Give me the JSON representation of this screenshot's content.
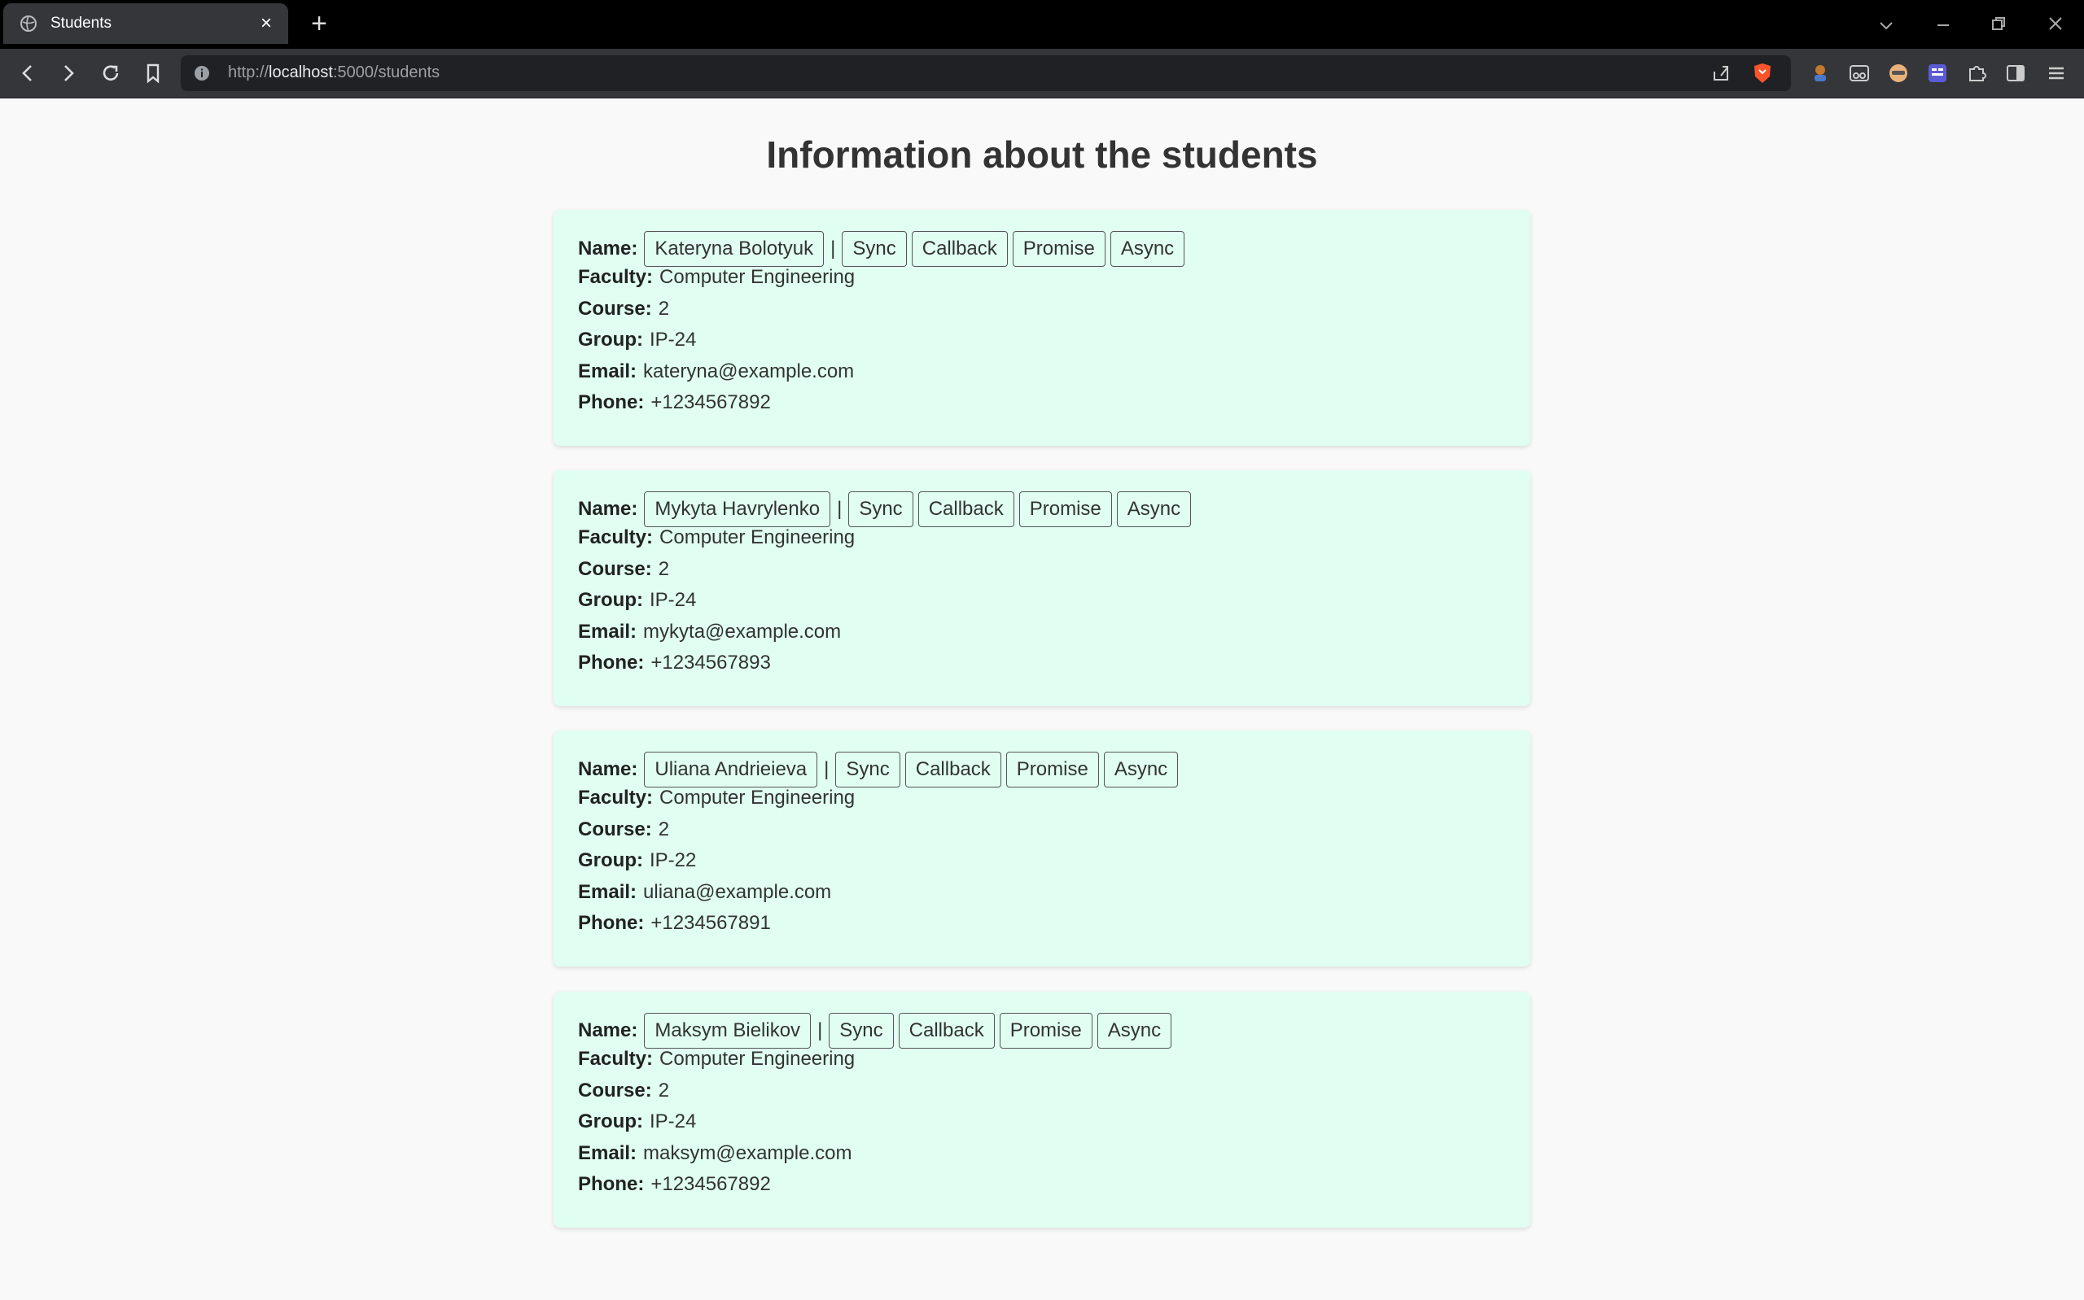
{
  "browser": {
    "tab_title": "Students",
    "url_prefix": "http://",
    "url_host": "localhost",
    "url_rest": ":5000/students"
  },
  "page": {
    "heading": "Information about the students",
    "labels": {
      "name": "Name:",
      "faculty": "Faculty:",
      "course": "Course:",
      "group": "Group:",
      "email": "Email:",
      "phone": "Phone:"
    },
    "separator": "|",
    "actions": [
      "Sync",
      "Callback",
      "Promise",
      "Async"
    ]
  },
  "students": [
    {
      "name": "Kateryna Bolotyuk",
      "faculty": "Computer Engineering",
      "course": "2",
      "group": "IP-24",
      "email": "kateryna@example.com",
      "phone": "+1234567892"
    },
    {
      "name": "Mykyta Havrylenko",
      "faculty": "Computer Engineering",
      "course": "2",
      "group": "IP-24",
      "email": "mykyta@example.com",
      "phone": "+1234567893"
    },
    {
      "name": "Uliana Andrieieva",
      "faculty": "Computer Engineering",
      "course": "2",
      "group": "IP-22",
      "email": "uliana@example.com",
      "phone": "+1234567891"
    },
    {
      "name": "Maksym Bielikov",
      "faculty": "Computer Engineering",
      "course": "2",
      "group": "IP-24",
      "email": "maksym@example.com",
      "phone": "+1234567892"
    }
  ]
}
